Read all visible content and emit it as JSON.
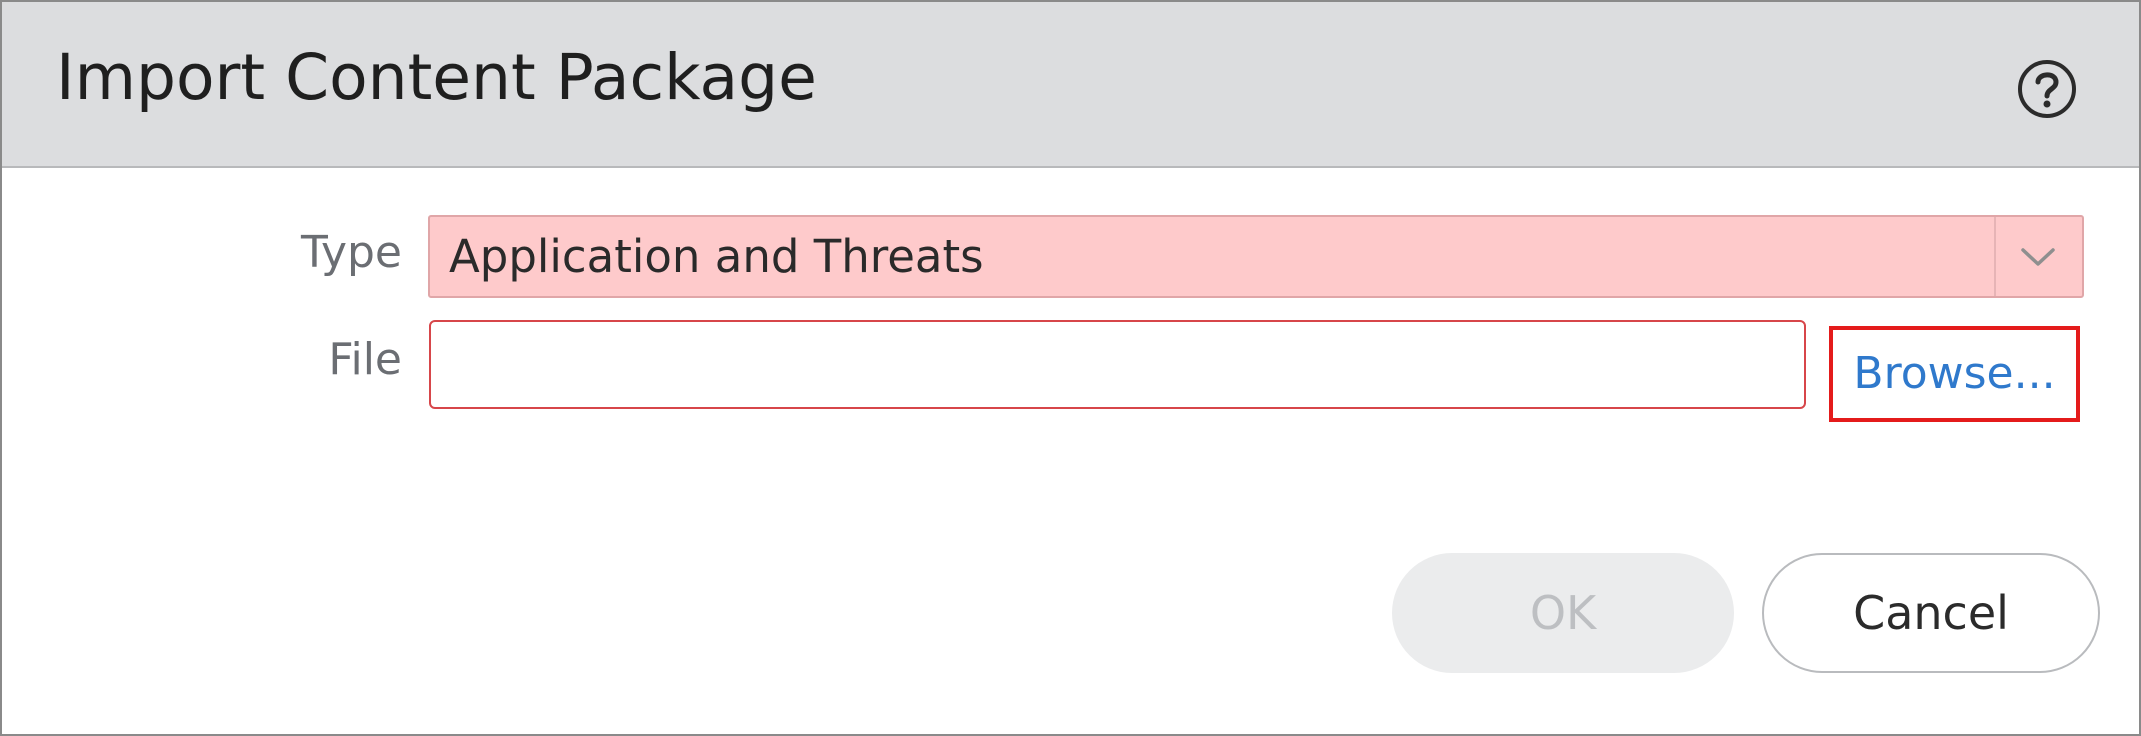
{
  "dialog": {
    "title": "Import Content Package",
    "help_icon": "question-circle-icon"
  },
  "form": {
    "type": {
      "label": "Type",
      "selected_value": "Application and Threats",
      "dropdown_icon": "chevron-down-icon",
      "background_color": "#fecacb"
    },
    "file": {
      "label": "File",
      "value": "",
      "placeholder": "",
      "border_color": "#d7464a"
    },
    "browse_label": "Browse...",
    "browse_highlight_color": "#e41b1b",
    "link_color": "#2f79cc"
  },
  "footer": {
    "ok_label": "OK",
    "ok_disabled": true,
    "cancel_label": "Cancel"
  }
}
